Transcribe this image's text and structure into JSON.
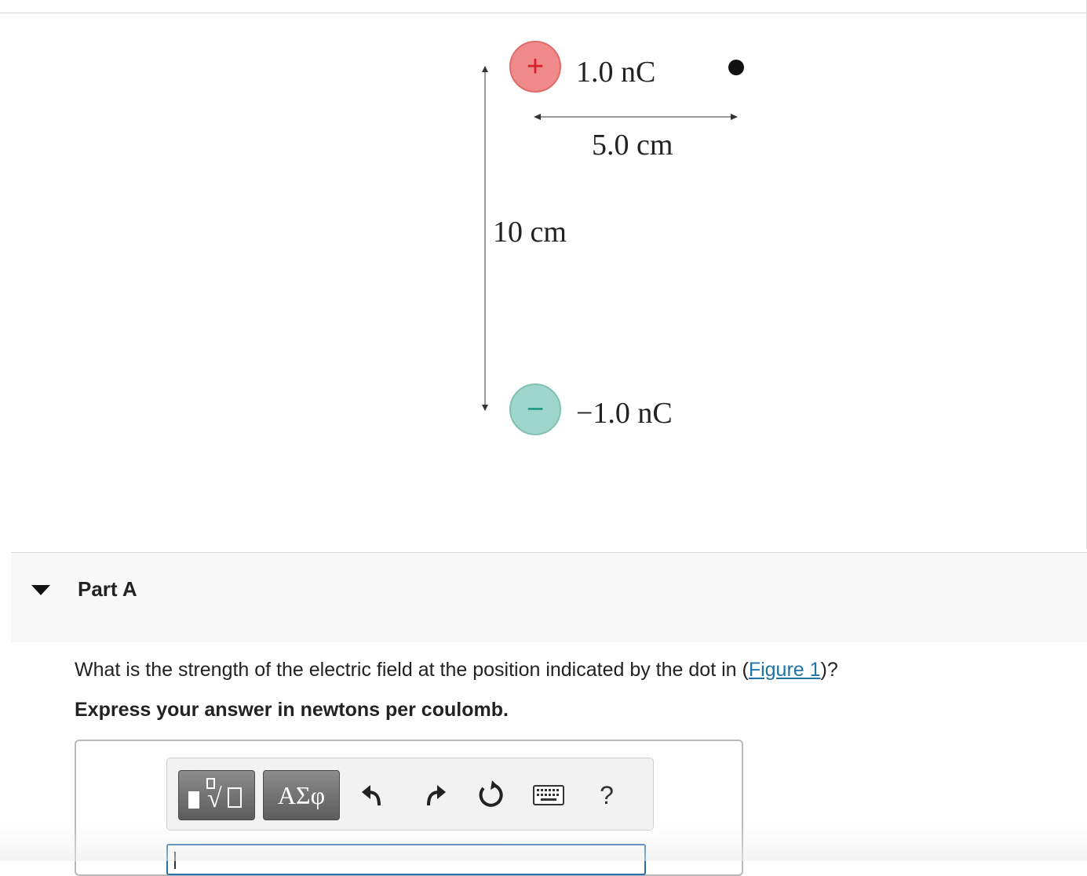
{
  "figure": {
    "positive_charge": {
      "sign": "+",
      "label": "1.0 nC",
      "color": "#f08a8a"
    },
    "negative_charge": {
      "sign": "−",
      "label": "−1.0 nC",
      "color": "#9fd6cb"
    },
    "horizontal_distance": "5.0 cm",
    "vertical_distance": "10 cm"
  },
  "part": {
    "title": "Part A"
  },
  "question": {
    "prefix": "What is the strength of the electric field at the position indicated by the dot in (",
    "link": "Figure 1",
    "suffix": ")?",
    "instruction": "Express your answer in newtons per coulomb."
  },
  "toolbar": {
    "symbols_label": "ΑΣφ",
    "help_label": "?",
    "icons": [
      "templates-icon",
      "undo-icon",
      "redo-icon",
      "reset-icon",
      "keyboard-icon",
      "help-icon"
    ]
  },
  "answer": {
    "value": ""
  }
}
